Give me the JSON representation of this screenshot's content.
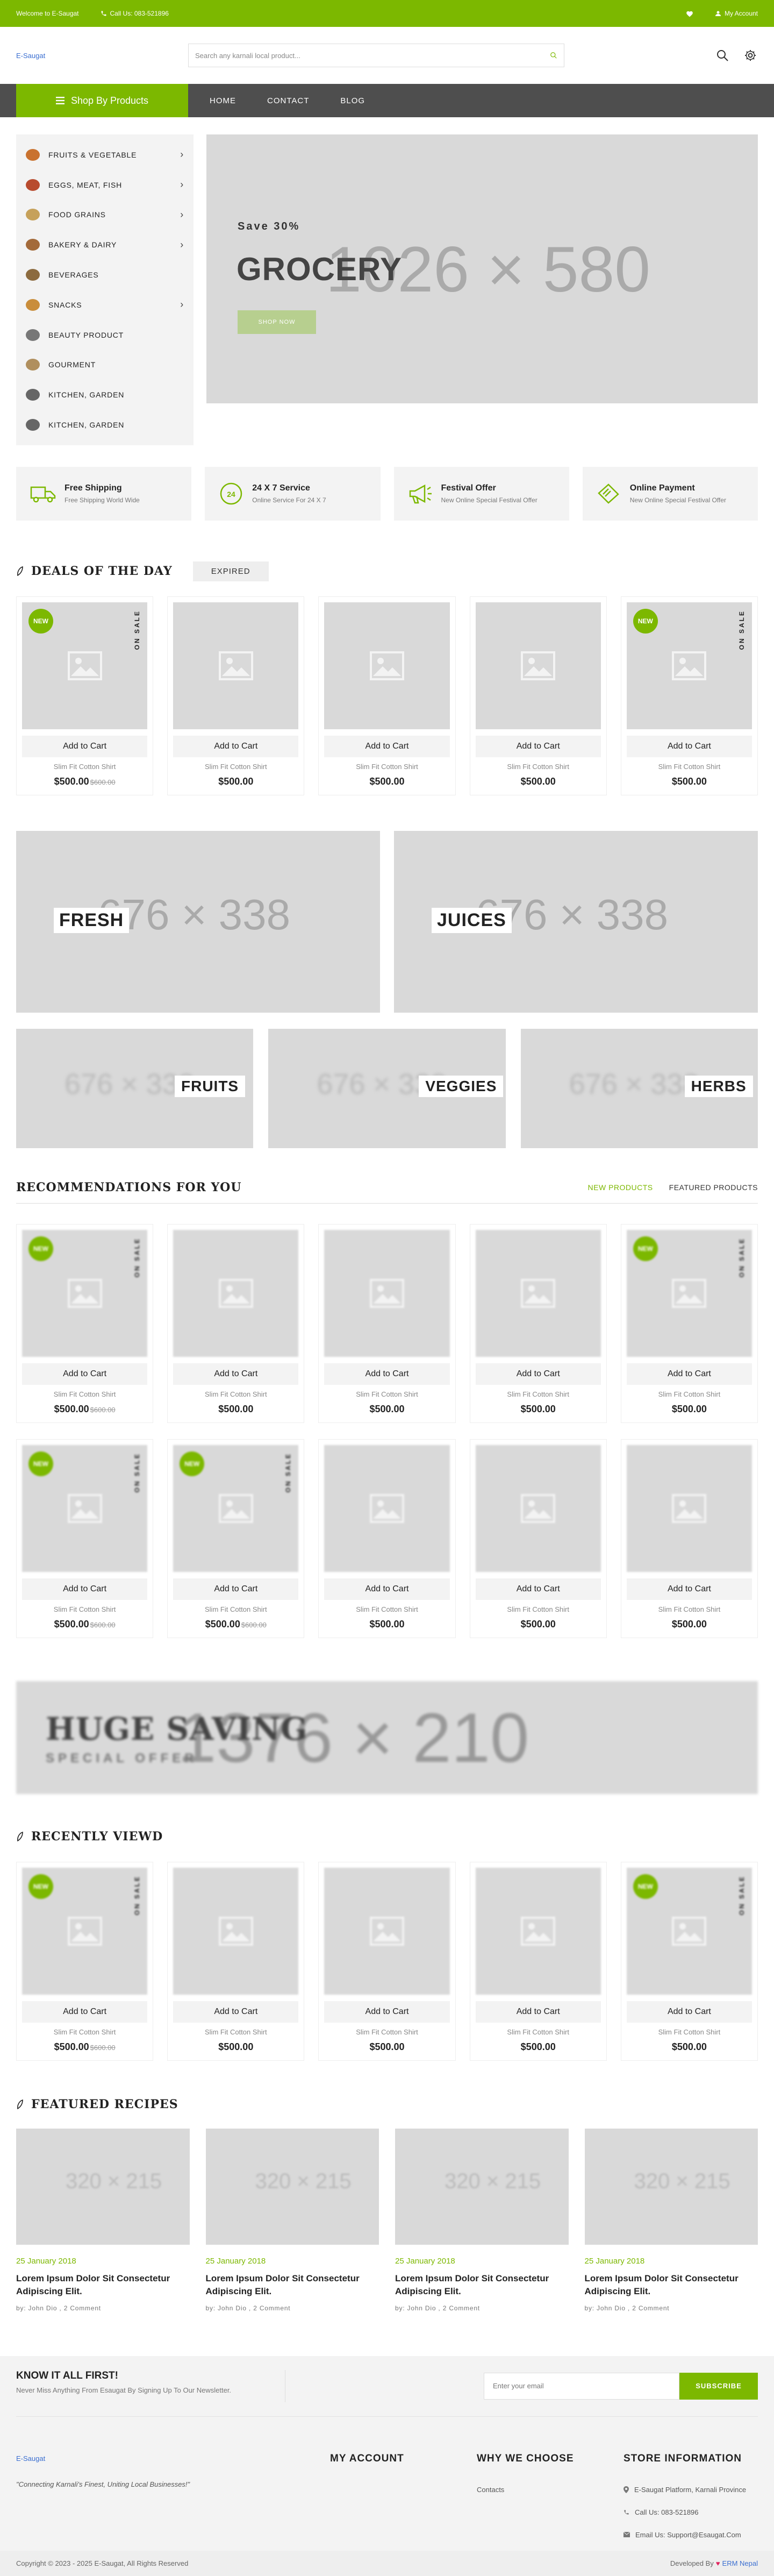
{
  "topbar": {
    "welcome": "Welcome to E-Saugat",
    "call": "Call Us: 083-521896",
    "account": "My Account",
    "icons": [
      "phone-icon",
      "heart-icon",
      "user-icon"
    ]
  },
  "header": {
    "logo": "E-Saugat",
    "search_placeholder": "Search any karnali local product...",
    "icons": [
      "search-icon",
      "settings-icon"
    ]
  },
  "nav": {
    "shop_by": "Shop By Products",
    "links": [
      "HOME",
      "CONTACT",
      "BLOG"
    ]
  },
  "categories": [
    {
      "label": "FRUITS & VEGETABLE",
      "arrow": true
    },
    {
      "label": "EGGS, MEAT, FISH",
      "arrow": true
    },
    {
      "label": "FOOD GRAINS",
      "arrow": true
    },
    {
      "label": "BAKERY & DAIRY",
      "arrow": true
    },
    {
      "label": "BEVERAGES",
      "arrow": false
    },
    {
      "label": "SNACKS",
      "arrow": true
    },
    {
      "label": "BEAUTY PRODUCT",
      "arrow": false
    },
    {
      "label": "GOURMENT",
      "arrow": false
    },
    {
      "label": "KITCHEN, GARDEN",
      "arrow": false
    },
    {
      "label": "KITCHEN, GARDEN",
      "arrow": false
    }
  ],
  "slider": {
    "placeholder": "1026 × 580",
    "save": "Save 30%",
    "title": "GROCERY",
    "button": "SHOP NOW"
  },
  "features": [
    {
      "title": "Free Shipping",
      "sub": "Free Shipping World Wide",
      "icon": "truck-icon"
    },
    {
      "title": "24 X 7 Service",
      "sub": "Online Service For 24 X 7",
      "icon": "clock-24-icon"
    },
    {
      "title": "Festival Offer",
      "sub": "New Online Special Festival Offer",
      "icon": "megaphone-icon"
    },
    {
      "title": "Online Payment",
      "sub": "New Online Special Festival Offer",
      "icon": "payment-card-icon"
    }
  ],
  "deals": {
    "title": "DEALS OF THE DAY",
    "expired": "EXPIRED",
    "products": [
      {
        "new": true,
        "sale": true,
        "name": "Slim Fit Cotton Shirt",
        "price": "$500.00",
        "old": "$600.00"
      },
      {
        "new": false,
        "sale": false,
        "name": "Slim Fit Cotton Shirt",
        "price": "$500.00",
        "old": ""
      },
      {
        "new": false,
        "sale": false,
        "name": "Slim Fit Cotton Shirt",
        "price": "$500.00",
        "old": ""
      },
      {
        "new": false,
        "sale": false,
        "name": "Slim Fit Cotton Shirt",
        "price": "$500.00",
        "old": ""
      },
      {
        "new": true,
        "sale": true,
        "name": "Slim Fit Cotton Shirt",
        "price": "$500.00",
        "old": ""
      }
    ]
  },
  "common": {
    "add_to_cart": "Add to Cart",
    "new": "NEW",
    "on_sale": "ON SALE"
  },
  "banners_large": [
    {
      "label": "FRESH",
      "placeholder": "676 × 338"
    },
    {
      "label": "JUICES",
      "placeholder": "676 × 338"
    }
  ],
  "banners_small": [
    {
      "label": "FRUITS",
      "placeholder": "676 × 338"
    },
    {
      "label": "VEGGIES",
      "placeholder": "676 × 338"
    },
    {
      "label": "HERBS",
      "placeholder": "676 × 338"
    }
  ],
  "recommendations": {
    "title": "RECOMMENDATIONS FOR YOU",
    "tabs": [
      "NEW PRODUCTS",
      "FEATURED PRODUCTS"
    ],
    "row1": [
      {
        "new": true,
        "sale": true,
        "name": "Slim Fit Cotton Shirt",
        "price": "$500.00",
        "old": "$600.00"
      },
      {
        "new": false,
        "sale": false,
        "name": "Slim Fit Cotton Shirt",
        "price": "$500.00",
        "old": ""
      },
      {
        "new": false,
        "sale": false,
        "name": "Slim Fit Cotton Shirt",
        "price": "$500.00",
        "old": ""
      },
      {
        "new": false,
        "sale": false,
        "name": "Slim Fit Cotton Shirt",
        "price": "$500.00",
        "old": ""
      },
      {
        "new": true,
        "sale": true,
        "name": "Slim Fit Cotton Shirt",
        "price": "$500.00",
        "old": ""
      }
    ],
    "row2": [
      {
        "new": true,
        "sale": true,
        "name": "Slim Fit Cotton Shirt",
        "price": "$500.00",
        "old": "$600.00"
      },
      {
        "new": true,
        "sale": true,
        "name": "Slim Fit Cotton Shirt",
        "price": "$500.00",
        "old": "$600.00"
      },
      {
        "new": false,
        "sale": false,
        "name": "Slim Fit Cotton Shirt",
        "price": "$500.00",
        "old": ""
      },
      {
        "new": false,
        "sale": false,
        "name": "Slim Fit Cotton Shirt",
        "price": "$500.00",
        "old": ""
      },
      {
        "new": false,
        "sale": false,
        "name": "Slim Fit Cotton Shirt",
        "price": "$500.00",
        "old": ""
      }
    ]
  },
  "huge_banner": {
    "title": "HUGE SAVING",
    "sub": "SPECIAL OFFER",
    "placeholder": "1376 × 210"
  },
  "recent": {
    "title": "RECENTLY VIEWD",
    "products": [
      {
        "new": true,
        "sale": true,
        "name": "Slim Fit Cotton Shirt",
        "price": "$500.00",
        "old": "$600.00"
      },
      {
        "new": false,
        "sale": false,
        "name": "Slim Fit Cotton Shirt",
        "price": "$500.00",
        "old": ""
      },
      {
        "new": false,
        "sale": false,
        "name": "Slim Fit Cotton Shirt",
        "price": "$500.00",
        "old": ""
      },
      {
        "new": false,
        "sale": false,
        "name": "Slim Fit Cotton Shirt",
        "price": "$500.00",
        "old": ""
      },
      {
        "new": true,
        "sale": true,
        "name": "Slim Fit Cotton Shirt",
        "price": "$500.00",
        "old": ""
      }
    ]
  },
  "recipes": {
    "title": "FEATURED RECIPES",
    "items": [
      {
        "placeholder": "320 × 215",
        "date": "25 January 2018",
        "title": "Lorem Ipsum Dolor Sit Consectetur Adipiscing Elit.",
        "meta": "by: John Dio , 2 Comment"
      },
      {
        "placeholder": "320 × 215",
        "date": "25 January 2018",
        "title": "Lorem Ipsum Dolor Sit Consectetur Adipiscing Elit.",
        "meta": "by: John Dio , 2 Comment"
      },
      {
        "placeholder": "320 × 215",
        "date": "25 January 2018",
        "title": "Lorem Ipsum Dolor Sit Consectetur Adipiscing Elit.",
        "meta": "by: John Dio , 2 Comment"
      },
      {
        "placeholder": "320 × 215",
        "date": "25 January 2018",
        "title": "Lorem Ipsum Dolor Sit Consectetur Adipiscing Elit.",
        "meta": "by: John Dio , 2 Comment"
      }
    ]
  },
  "newsletter": {
    "title": "KNOW IT ALL FIRST!",
    "sub": "Never Miss Anything From Esaugat By Signing Up To Our Newsletter.",
    "placeholder": "Enter your email",
    "button": "SUBSCRIBE"
  },
  "footer": {
    "logo": "E-Saugat",
    "tagline": "\"Connecting Karnali's Finest, Uniting Local Businesses!\"",
    "col1": "MY ACCOUNT",
    "col2": "WHY WE CHOOSE",
    "col2_link": "Contacts",
    "col3": "STORE INFORMATION",
    "address": "E-Saugat Platform, Karnali Province",
    "phone": "Call Us: 083-521896",
    "email": "Email Us: Support@Esaugat.Com"
  },
  "bottom": {
    "copyright": "Copyright © 2023 - 2025 E-Saugat, All Rights Reserved",
    "developed": "Developed By",
    "brand": "ERM Nepal"
  },
  "colors": {
    "accent": "#7cb800",
    "nav": "#4e4e4e",
    "placeholder": "#d9d9d9"
  }
}
